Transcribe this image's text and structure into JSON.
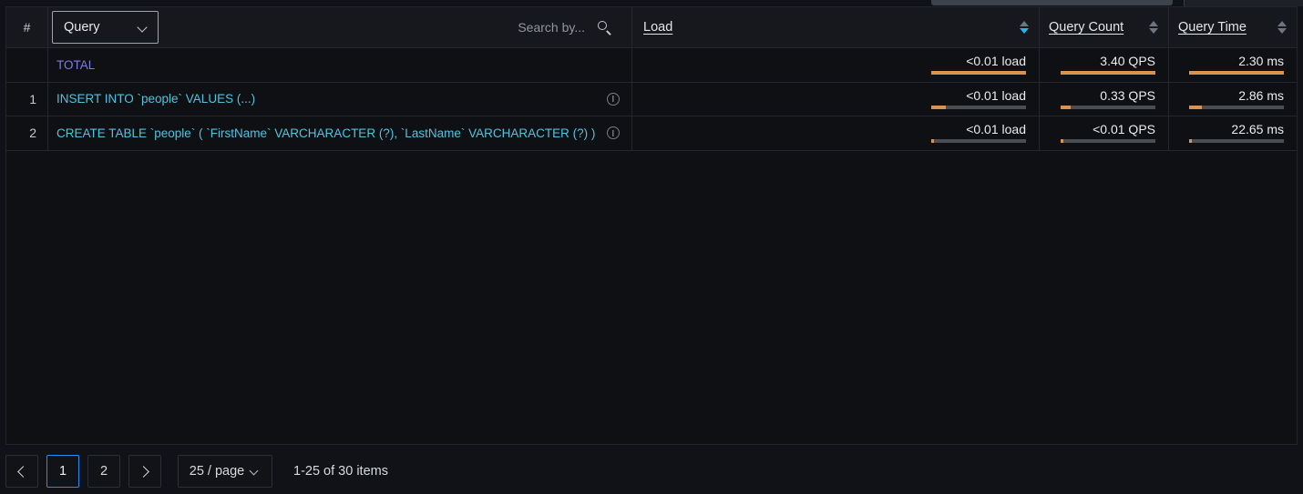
{
  "top_stubs": [
    {
      "name": "cut-off-widget-left"
    },
    {
      "name": "cut-off-widget-right"
    }
  ],
  "table": {
    "columns": {
      "num": "#",
      "query_filter_label": "Query",
      "load": "Load",
      "query_count": "Query Count",
      "query_time": "Query Time"
    },
    "search": {
      "placeholder": "Search by...",
      "value": ""
    },
    "sort": {
      "active_column": "Load",
      "direction": "desc"
    },
    "rows": [
      {
        "num": "",
        "query": "TOTAL",
        "is_total": true,
        "has_info": false,
        "load": {
          "value": "<0.01 load",
          "fill_pct": 100
        },
        "query_count": {
          "value": "3.40 QPS",
          "fill_pct": 100
        },
        "query_time": {
          "value": "2.30 ms",
          "fill_pct": 100
        }
      },
      {
        "num": "1",
        "query": "INSERT INTO `people` VALUES (...)",
        "is_total": false,
        "has_info": true,
        "load": {
          "value": "<0.01 load",
          "fill_pct": 15
        },
        "query_count": {
          "value": "0.33 QPS",
          "fill_pct": 11
        },
        "query_time": {
          "value": "2.86 ms",
          "fill_pct": 13
        }
      },
      {
        "num": "2",
        "query": "CREATE TABLE `people` ( `FirstName` VARCHARACTER (?), `LastName` VARCHARACTER (?) )",
        "is_total": false,
        "has_info": true,
        "load": {
          "value": "<0.01 load",
          "fill_pct": 3
        },
        "query_count": {
          "value": "<0.01 QPS",
          "fill_pct": 3
        },
        "query_time": {
          "value": "22.65 ms",
          "fill_pct": 3
        }
      }
    ]
  },
  "pagination": {
    "prev_label": "",
    "next_label": "",
    "pages": [
      {
        "label": "1",
        "current": true
      },
      {
        "label": "2",
        "current": false
      }
    ],
    "page_size_label": "25 / page",
    "summary": "1-25 of 30 items"
  },
  "colors": {
    "accent_bar": "#da9251",
    "link": "#4fc4e0",
    "total_link": "#7b7ce0",
    "sort_active": "#21b6f0",
    "page_active_border": "#1f8efa"
  }
}
